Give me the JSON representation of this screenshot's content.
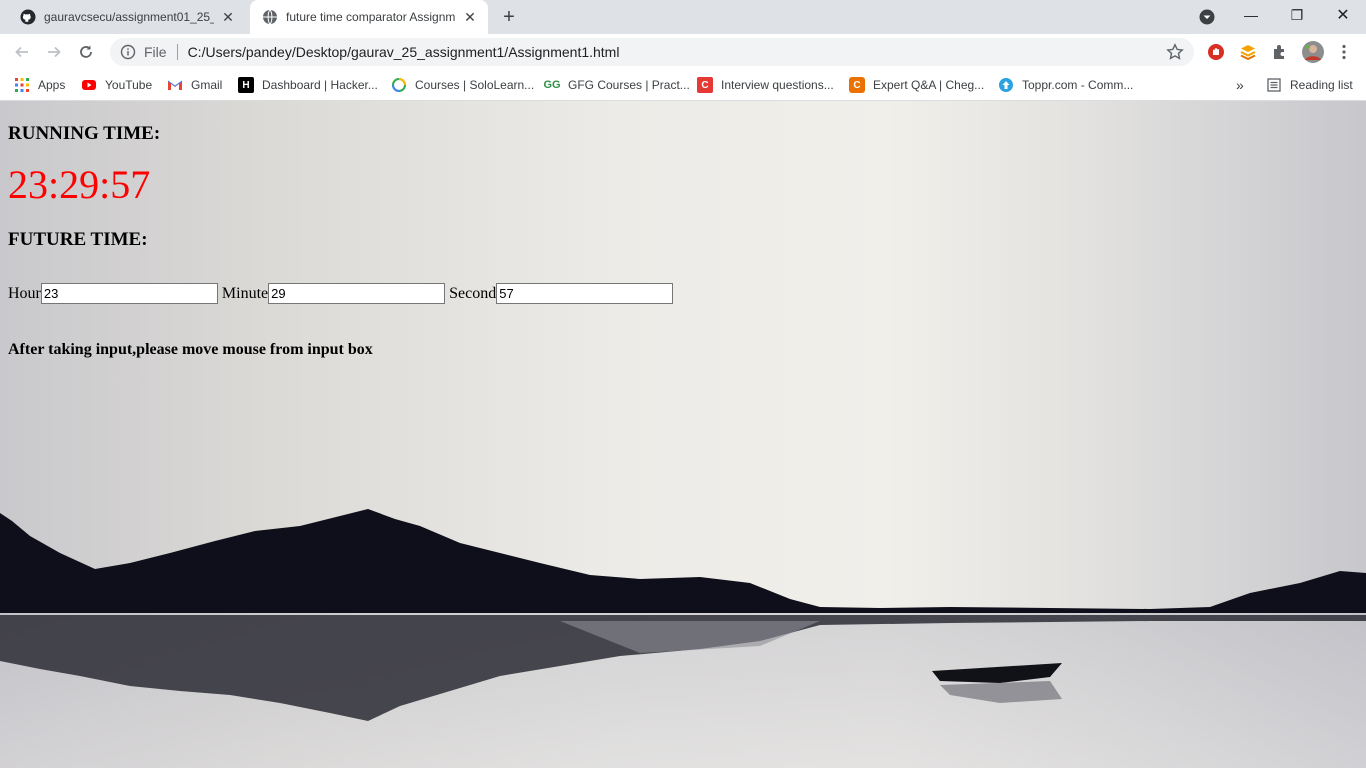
{
  "browser": {
    "tabs": [
      {
        "title": "gauravcsecu/assignment01_25_g",
        "icon": "github-icon",
        "active": false
      },
      {
        "title": "future time comparator Assignm",
        "icon": "globe-icon",
        "active": true
      }
    ],
    "address": {
      "scheme": "File",
      "url": "C:/Users/pandey/Desktop/gaurav_25_assignment1/Assignment1.html"
    },
    "bookmarks": [
      {
        "label": "Apps",
        "icon": "apps-grid-icon",
        "color": "#4285f4"
      },
      {
        "label": "YouTube",
        "icon": "youtube-icon",
        "color": "#ff0000"
      },
      {
        "label": "Gmail",
        "icon": "gmail-icon",
        "color": "#ea4335"
      },
      {
        "label": "Dashboard | Hacker...",
        "icon": "hackerrank-icon",
        "color": "#000000"
      },
      {
        "label": "Courses | SoloLearn...",
        "icon": "sololearn-icon",
        "color": "#34a853"
      },
      {
        "label": "GFG Courses | Pract...",
        "icon": "gfg-icon",
        "color": "#2f8d46"
      },
      {
        "label": "Interview questions...",
        "icon": "c-icon",
        "color": "#e53935"
      },
      {
        "label": "Expert Q&A | Cheg...",
        "icon": "chegg-icon",
        "color": "#eb7100"
      },
      {
        "label": "Toppr.com - Comm...",
        "icon": "toppr-icon",
        "color": "#2aa3e0"
      }
    ],
    "overflow_label": "»",
    "reading_list": "Reading list"
  },
  "page": {
    "running_heading": "RUNNING TIME:",
    "running_clock": "23:29:57",
    "future_heading": "FUTURE TIME:",
    "inputs": [
      {
        "label": "Hour",
        "value": "23"
      },
      {
        "label": "Minute",
        "value": "29"
      },
      {
        "label": "Second",
        "value": "57"
      }
    ],
    "note": "After taking input,please move mouse from input box",
    "clock_color": "#ff0000"
  }
}
